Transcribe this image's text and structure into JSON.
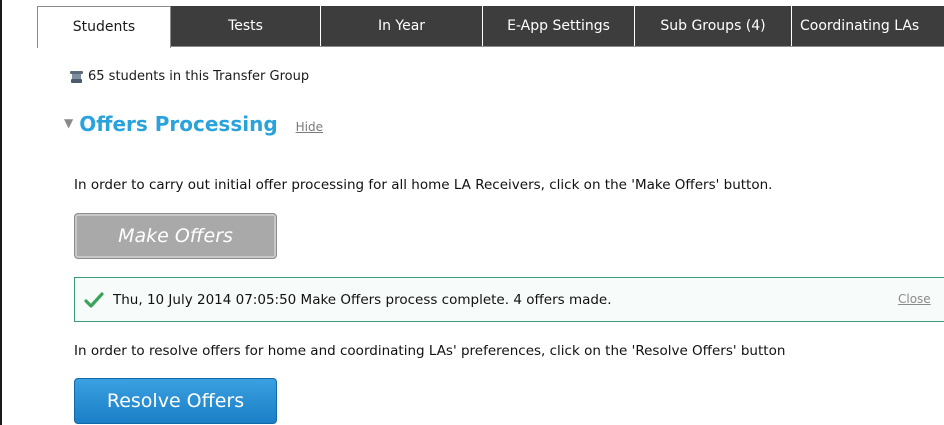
{
  "tabs": [
    {
      "label": "Students"
    },
    {
      "label": "Tests"
    },
    {
      "label": "In Year"
    },
    {
      "label": "E-App Settings"
    },
    {
      "label": "Sub Groups  (4)"
    },
    {
      "label": "Coordinating LAs"
    }
  ],
  "students": {
    "icon": "student-group-icon",
    "count_text": "65 students in this Transfer Group"
  },
  "section": {
    "title": "Offers Processing",
    "hide_label": "Hide"
  },
  "make_offers": {
    "instruction": "In order to carry out initial offer processing for all home LA Receivers, click on the 'Make Offers' button.",
    "button_label": "Make Offers"
  },
  "notice": {
    "icon": "check-icon",
    "message": "Thu, 10 July 2014 07:05:50 Make Offers process complete. 4 offers made.",
    "close_label": "Close"
  },
  "resolve_offers": {
    "instruction": "In order to resolve offers for home and coordinating LAs' preferences, click on the 'Resolve Offers' button",
    "button_label": "Resolve Offers"
  },
  "colors": {
    "accent": "#2aa3dc",
    "tab_dark": "#3d3d3d",
    "notice_border": "#3a9c7a"
  }
}
